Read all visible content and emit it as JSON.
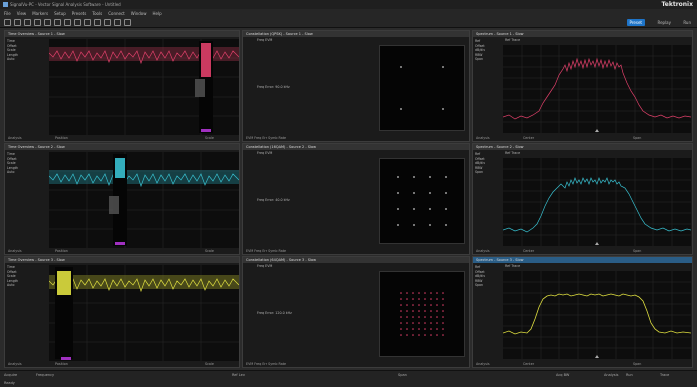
{
  "app": {
    "title": "SignalVu-PC - Vector Signal Analysis Software - Untitled",
    "brand": "Tektronix"
  },
  "menu": [
    "File",
    "View",
    "Markers",
    "Setup",
    "Presets",
    "Tools",
    "Connect",
    "Window",
    "Help"
  ],
  "toolbar": {
    "preset_label": "Preset",
    "replay_label": "Replay",
    "run_label": "Run"
  },
  "colors": {
    "source1": "#e0406a",
    "source2": "#38c0d0",
    "source3": "#e0e040",
    "header_active": "#2a5d86",
    "accent": "#1e74c8"
  },
  "panels": {
    "time1": {
      "title": "Time Overview - Source 1 - Slow",
      "settings": [
        "Time",
        "Offset",
        "Scale",
        "Length",
        "Auto"
      ],
      "footer_left": "Analysis",
      "footer_mid": "Position",
      "footer_right": "Scale"
    },
    "time2": {
      "title": "Time Overview - Source 2 - Slow",
      "settings": [
        "Time",
        "Offset",
        "Scale",
        "Length",
        "Auto"
      ],
      "footer_left": "Analysis",
      "footer_mid": "Position",
      "footer_right": "Scale"
    },
    "time3": {
      "title": "Time Overview - Source 3 - Slow",
      "settings": [
        "Time",
        "Offset",
        "Scale",
        "Length",
        "Auto"
      ],
      "footer_left": "Analysis",
      "footer_mid": "Position",
      "footer_right": "Scale"
    },
    "const1": {
      "title": "Constellation (QPSK) - Source 1 - Slow",
      "top_text": "Freq   EVM",
      "note": "Freq Error: 90.0 kHz",
      "footer": "EVM   Freq Err   Symb Rate"
    },
    "const2": {
      "title": "Constellation (16QAM) - Source 2 - Slow",
      "top_text": "Freq   EVM",
      "note": "Freq Error: 40.0 kHz",
      "footer": "EVM   Freq Err   Symb Rate"
    },
    "const3": {
      "title": "Constellation (64QAM) - Source 3 - Slow",
      "top_text": "Freq   EVM",
      "note": "Freq Error: 120.0 kHz",
      "footer": "EVM   Freq Err   Symb Rate"
    },
    "spec1": {
      "title": "Spectrum - Source 1 - Slow",
      "top_text": "Ref   Trace",
      "settings": [
        "Ref",
        "Offset",
        "dB/div",
        "RBW",
        "Span"
      ],
      "footer_left": "Analysis",
      "footer_center": "Center",
      "footer_right": "Span"
    },
    "spec2": {
      "title": "Spectrum - Source 2 - Slow",
      "top_text": "Ref   Trace",
      "settings": [
        "Ref",
        "Offset",
        "dB/div",
        "RBW",
        "Span"
      ],
      "footer_left": "Analysis",
      "footer_center": "Center",
      "footer_right": "Span"
    },
    "spec3": {
      "title": "Spectrum - Source 3 - Slow",
      "top_text": "Ref   Trace",
      "settings": [
        "Ref",
        "Offset",
        "dB/div",
        "RBW",
        "Span"
      ],
      "footer_left": "Analysis",
      "footer_center": "Center",
      "footer_right": "Span"
    }
  },
  "status": {
    "acquire_label": "Acquire",
    "frequency_label": "Frequency",
    "ref_lev_label": "Ref Lev",
    "span_label": "Span",
    "acq_bw_label": "Acq BW",
    "run_label": "Run",
    "analysis_label": "Analysis",
    "trace_label": "Trace",
    "ready": "Ready"
  }
}
